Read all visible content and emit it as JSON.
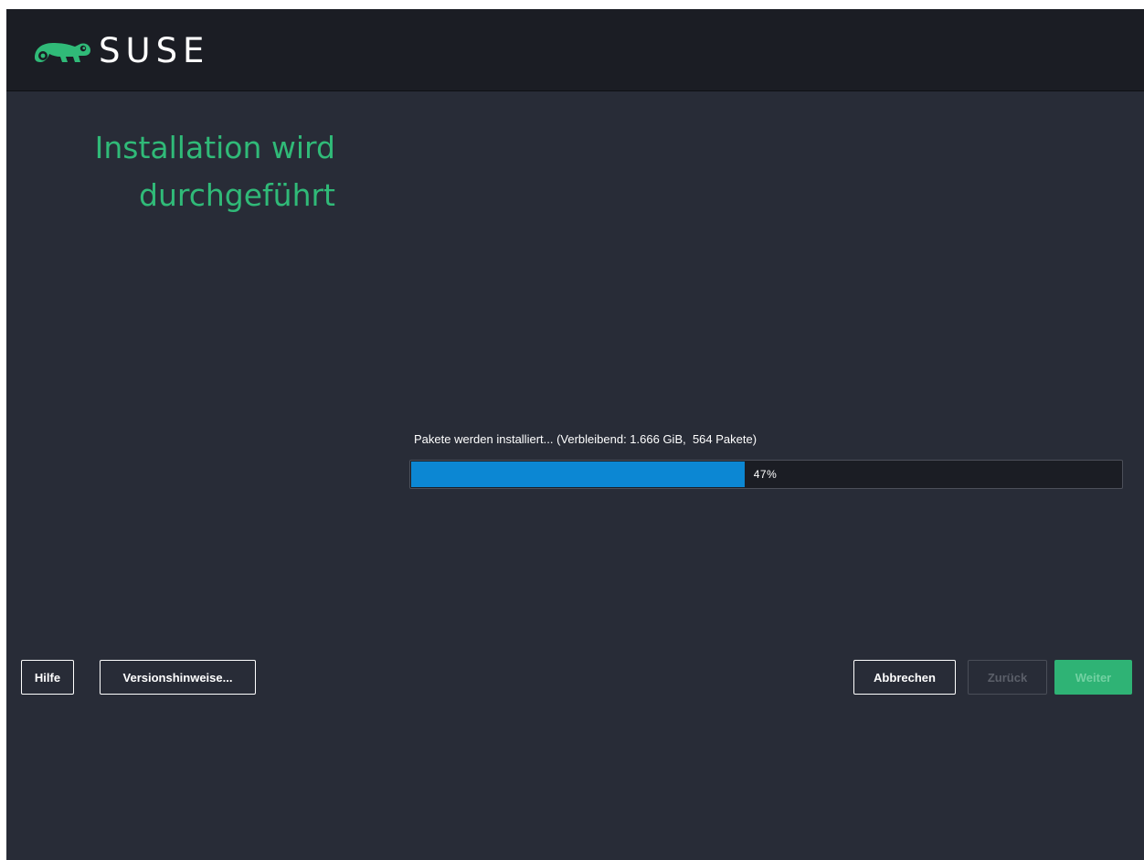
{
  "header": {
    "brand": "SUSE"
  },
  "main": {
    "title_line1": "Installation wird",
    "title_line2": "durchgeführt",
    "progress_label": "Pakete werden installiert... (Verbleibend: 1.666 GiB,  564 Pakete)",
    "progress_percent": 47,
    "progress_text": "47%"
  },
  "buttons": {
    "help": "Hilfe",
    "release_notes": "Versionshinweise...",
    "abort": "Abbrechen",
    "back": "Zurück",
    "next": "Weiter"
  },
  "colors": {
    "accent_green": "#30ba78",
    "progress_blue": "#0c87d3",
    "background": "#282c37",
    "header": "#1b1d24"
  },
  "icons": {
    "logo": "suse-chameleon-icon"
  }
}
